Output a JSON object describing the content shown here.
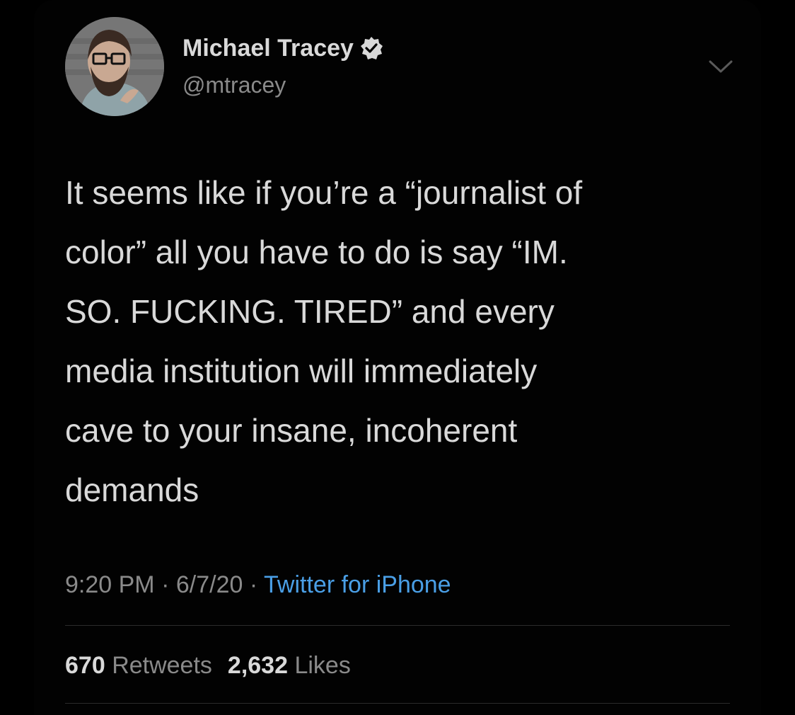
{
  "author": {
    "display_name": "Michael Tracey",
    "handle": "@mtracey",
    "verified_icon": "verified-badge-icon",
    "avatar_icon": "avatar"
  },
  "tweet": {
    "lines": [
      "It seems like if you’re a “journalist of",
      "color” all you have to do is say “IM.",
      "SO. FUCKING. TIRED” and every",
      "media institution will immediately",
      "cave to your insane, incoherent",
      "demands"
    ]
  },
  "meta": {
    "time": "9:20 PM",
    "separator": "·",
    "date": "6/7/20",
    "source": "Twitter for iPhone"
  },
  "stats": {
    "retweets_count": "670",
    "retweets_label": "Retweets",
    "likes_count": "2,632",
    "likes_label": "Likes"
  },
  "colors": {
    "background": "#000000",
    "text": "#d9d9d9",
    "secondary": "#8a8a8a",
    "link": "#4a9fe6",
    "divider": "#2b2b2b"
  }
}
